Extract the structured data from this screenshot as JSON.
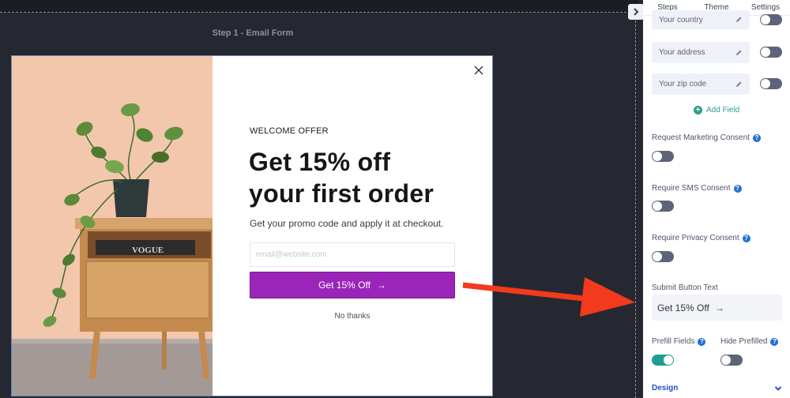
{
  "canvas": {
    "step_title": "Step 1 - Email Form"
  },
  "popup": {
    "eyebrow": "WELCOME OFFER",
    "headline_line1": "Get 15% off",
    "headline_line2": "your first order",
    "subtext": "Get your promo code and apply it at checkout.",
    "email_placeholder": "email@website.com",
    "submit_label": "Get 15% Off",
    "submit_arrow": "→",
    "no_thanks": "No thanks",
    "brand_color": "#9a25b8",
    "image_book_text": "VOGUE"
  },
  "panel": {
    "tabs": [
      "Steps",
      "Theme",
      "Settings"
    ],
    "fields": [
      {
        "label": "Your country",
        "enabled": false
      },
      {
        "label": "Your address",
        "enabled": false
      },
      {
        "label": "Your zip code",
        "enabled": false
      }
    ],
    "add_field": "Add Field",
    "request_marketing_consent": {
      "label": "Request Marketing Consent",
      "enabled": false
    },
    "require_sms_consent": {
      "label": "Require SMS Consent",
      "enabled": false
    },
    "require_privacy_consent": {
      "label": "Require Privacy Consent",
      "enabled": false
    },
    "submit_button_text_label": "Submit Button Text",
    "submit_button_text_value": "Get 15% Off",
    "submit_button_text_arrow": "→",
    "prefill_fields": {
      "label": "Prefill Fields",
      "enabled": true
    },
    "hide_prefilled": {
      "label": "Hide Prefilled",
      "enabled": false
    },
    "design_label": "Design",
    "help_glyph": "?",
    "toggle_on_color": "#1f9e8f",
    "toggle_off_color": "#5e6478"
  }
}
